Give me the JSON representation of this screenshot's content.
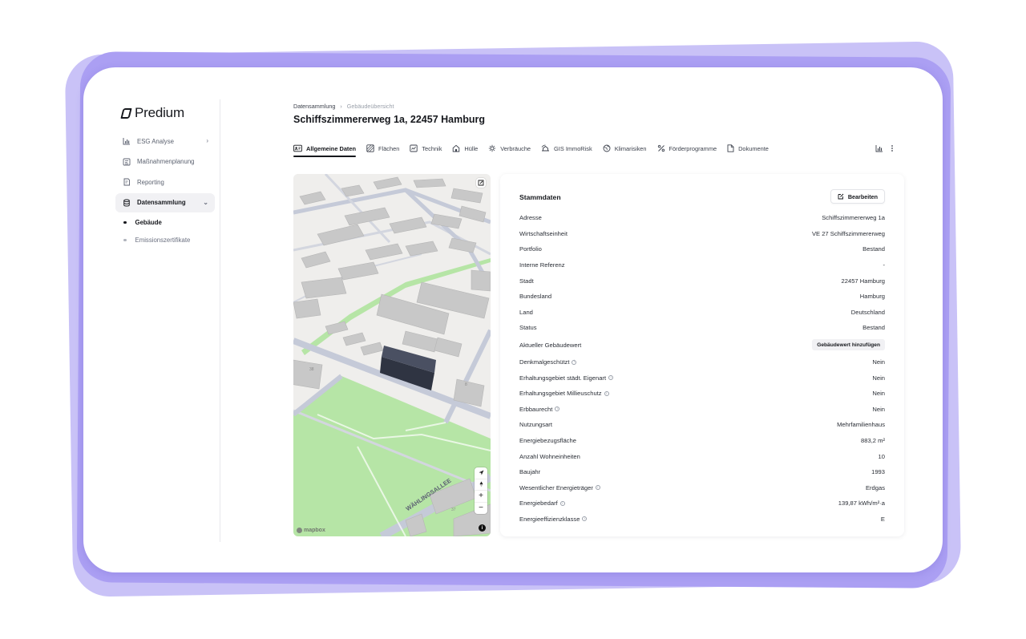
{
  "app": {
    "logo_text": "Predium"
  },
  "sidebar": {
    "items": [
      {
        "label": "ESG Analyse",
        "icon": "bar-chart-icon"
      },
      {
        "label": "Maßnahmenplanung",
        "icon": "plan-icon"
      },
      {
        "label": "Reporting",
        "icon": "report-icon"
      },
      {
        "label": "Datensammlung",
        "icon": "database-icon"
      }
    ],
    "sub_items": [
      {
        "label": "Gebäude"
      },
      {
        "label": "Emissionszertifikate"
      }
    ]
  },
  "breadcrumb": {
    "parent": "Datensammlung",
    "current": "Gebäudeübersicht"
  },
  "page": {
    "title": "Schiffszimmererweg 1a, 22457 Hamburg"
  },
  "tabs": [
    {
      "label": "Allgemeine Daten",
      "icon": "id-card-icon"
    },
    {
      "label": "Flächen",
      "icon": "area-icon"
    },
    {
      "label": "Technik",
      "icon": "tech-icon"
    },
    {
      "label": "Hülle",
      "icon": "house-icon"
    },
    {
      "label": "Verbräuche",
      "icon": "consumption-icon"
    },
    {
      "label": "GIS ImmoRisk",
      "icon": "gis-icon"
    },
    {
      "label": "Klimarisiken",
      "icon": "globe-icon"
    },
    {
      "label": "Förderprogramme",
      "icon": "percent-icon"
    },
    {
      "label": "Dokumente",
      "icon": "document-icon"
    }
  ],
  "map": {
    "street_label": "WÄHLINGSALLEE",
    "house_numbers": [
      "37",
      "8",
      "38"
    ],
    "attribution": "mapbox",
    "zoom_in": "+",
    "zoom_out": "−",
    "info": "i"
  },
  "stammdaten": {
    "title": "Stammdaten",
    "edit_label": "Bearbeiten",
    "rows": [
      {
        "key": "Adresse",
        "value": "Schiffszimmererweg 1a"
      },
      {
        "key": "Wirtschaftseinheit",
        "value": "VE 27 Schiffszimmererweg"
      },
      {
        "key": "Portfolio",
        "value": "Bestand"
      },
      {
        "key": "Interne Referenz",
        "value": "-"
      },
      {
        "key": "Stadt",
        "value": "22457 Hamburg"
      },
      {
        "key": "Bundesland",
        "value": "Hamburg"
      },
      {
        "key": "Land",
        "value": "Deutschland"
      },
      {
        "key": "Status",
        "value": "Bestand"
      },
      {
        "key": "Aktueller Gebäudewert",
        "button": "Gebäudewert hinzufügen"
      },
      {
        "key": "Denkmalgeschützt",
        "value": "Nein",
        "info": "i"
      },
      {
        "key": "Erhaltungsgebiet städt. Eigenart",
        "value": "Nein",
        "info": "i"
      },
      {
        "key": "Erhaltungsgebiet Millieuschutz",
        "value": "Nein",
        "info": "i"
      },
      {
        "key": "Erbbaurecht",
        "value": "Nein",
        "info": "i"
      },
      {
        "key": "Nutzungsart",
        "value": "Mehrfamilienhaus"
      },
      {
        "key": "Energiebezugsfläche",
        "value": "883,2 m²"
      },
      {
        "key": "Anzahl Wohneinheiten",
        "value": "10"
      },
      {
        "key": "Baujahr",
        "value": "1993"
      },
      {
        "key": "Wesentlicher Energieträger",
        "value": "Erdgas",
        "info": "i"
      },
      {
        "key": "Energiebedarf",
        "value": "139,87 kWh/m²·a",
        "info": "i"
      },
      {
        "key": "Energieeffizienzklasse",
        "value": "E",
        "info": "i"
      }
    ]
  },
  "colors": {
    "frame_light": "#c9c2f7",
    "frame_mid": "#ab9ff3",
    "map_green": "#b5e3a4",
    "building_highlight": "#353a48"
  }
}
